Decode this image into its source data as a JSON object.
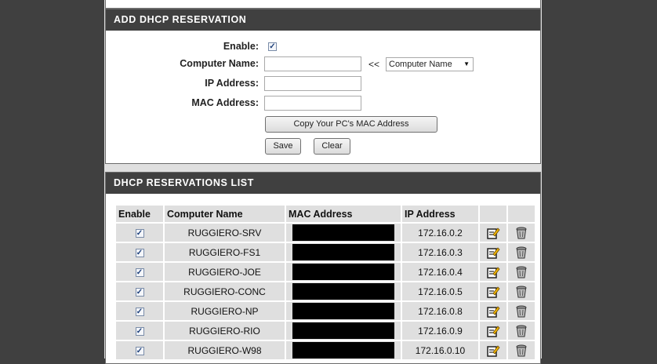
{
  "add_section": {
    "title": "ADD DHCP RESERVATION",
    "enable_label": "Enable:",
    "enable_mark": "✓",
    "computer_name_label": "Computer Name:",
    "computer_name_value": "",
    "arrows": "<<",
    "computer_select_value": "Computer Name",
    "ip_label": "IP Address:",
    "ip_value": "",
    "mac_label": "MAC Address:",
    "mac_value": "",
    "copy_mac_button": "Copy Your PC's MAC Address",
    "save_button": "Save",
    "clear_button": "Clear"
  },
  "list_section": {
    "title": "DHCP RESERVATIONS LIST",
    "headers": [
      "Enable",
      "Computer Name",
      "MAC Address",
      "IP Address"
    ],
    "rows": [
      {
        "enabled": "✓",
        "name": "RUGGIERO-SRV",
        "ip": "172.16.0.2"
      },
      {
        "enabled": "✓",
        "name": "RUGGIERO-FS1",
        "ip": "172.16.0.3"
      },
      {
        "enabled": "✓",
        "name": "RUGGIERO-JOE",
        "ip": "172.16.0.4"
      },
      {
        "enabled": "✓",
        "name": "RUGGIERO-CONC",
        "ip": "172.16.0.5"
      },
      {
        "enabled": "✓",
        "name": "RUGGIERO-NP",
        "ip": "172.16.0.8"
      },
      {
        "enabled": "✓",
        "name": "RUGGIERO-RIO",
        "ip": "172.16.0.9"
      },
      {
        "enabled": "✓",
        "name": "RUGGIERO-W98",
        "ip": "172.16.0.10"
      }
    ]
  },
  "icons": {
    "edit": "edit-icon",
    "delete": "trash-icon"
  }
}
